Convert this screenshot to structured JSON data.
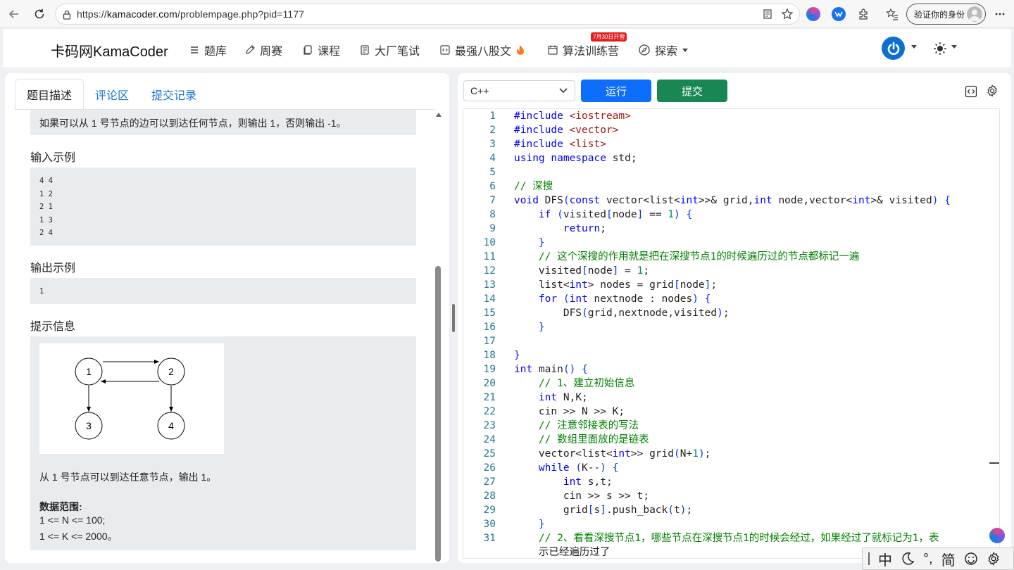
{
  "browser": {
    "url_prefix": "https://",
    "url_host": "kamacoder.com",
    "url_path": "/problempage.php?pid=1177",
    "profile_label": "验证你的身份"
  },
  "nav": {
    "logo": "卡码网KamaCoder",
    "items": [
      "题库",
      "周赛",
      "课程",
      "大厂笔试",
      "最强八股文",
      "算法训练营",
      "探索"
    ],
    "badge": "7月30日开营"
  },
  "left": {
    "tabs": [
      "题目描述",
      "评论区",
      "提交记录"
    ],
    "top_text": "如果可以从 1 号节点的边可以到达任何节点，则输出 1，否则输出 -1。",
    "input_title": "输入示例",
    "input_lines": [
      "4 4",
      "1 2",
      "2 1",
      "1 3",
      "2 4"
    ],
    "output_title": "输出示例",
    "output_value": "1",
    "hint_title": "提示信息",
    "graph_nodes": [
      "1",
      "2",
      "3",
      "4"
    ],
    "hint_text": "从 1 号节点可以到达任意节点，输出 1。",
    "range_title": "数据范围:",
    "range_lines": [
      "1 <= N <= 100;",
      "1 <= K <= 2000。"
    ]
  },
  "right": {
    "language": "C++",
    "run_label": "运行",
    "submit_label": "提交"
  },
  "code_lines": [
    "#include <iostream>",
    "#include <vector>",
    "#include <list>",
    "using namespace std;",
    "",
    "// 深搜",
    "void DFS(const vector<list<int>>& grid,int node,vector<int>& visited) {",
    "    if (visited[node] == 1) {",
    "        return;",
    "    }",
    "    // 这个深搜的作用就是把在深搜节点1的时候遍历过的节点都标记一遍",
    "    visited[node] = 1;",
    "    list<int> nodes = grid[node];",
    "    for (int nextnode : nodes) {",
    "        DFS(grid,nextnode,visited);",
    "    }",
    "",
    "}",
    "int main() {",
    "    // 1、建立初始信息",
    "    int N,K;",
    "    cin >> N >> K;",
    "    // 注意邻接表的写法",
    "    // 数组里面放的是链表",
    "    vector<list<int>> grid(N+1);",
    "    while (K--) {",
    "        int s,t;",
    "        cin >> s >> t;",
    "        grid[s].push_back(t);",
    "    }",
    "    // 2、看看深搜节点1，哪些节点在深搜节点1的时候会经过，如果经过了就标记为1，表",
    "    示已经遍历过了"
  ],
  "line_numbers": [
    "1",
    "2",
    "3",
    "4",
    "5",
    "6",
    "7",
    "8",
    "9",
    "10",
    "11",
    "12",
    "13",
    "14",
    "15",
    "16",
    "17",
    "18",
    "19",
    "20",
    "21",
    "22",
    "23",
    "24",
    "25",
    "26",
    "27",
    "28",
    "29",
    "30",
    "31"
  ],
  "ime": {
    "chars": [
      "中",
      "°,",
      "简"
    ]
  }
}
